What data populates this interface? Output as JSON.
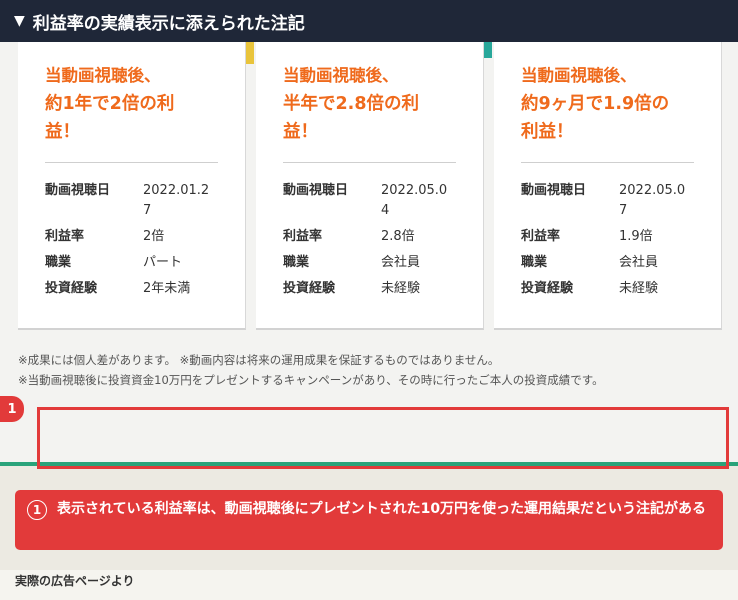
{
  "header": {
    "arrow": "▼",
    "title": "利益率の実績表示に添えられた注記"
  },
  "cards": [
    {
      "headline_lines": [
        "当動画視聴後、",
        "約1年で2倍の利",
        "益！"
      ],
      "rows": [
        {
          "label": "動画視聴日",
          "value": "2022.01.2\n7"
        },
        {
          "label": "利益率",
          "value": "2倍"
        },
        {
          "label": "職業",
          "value": "パート"
        },
        {
          "label": "投資経験",
          "value": "2年未満"
        }
      ]
    },
    {
      "headline_lines": [
        "当動画視聴後、",
        "半年で2.8倍の利",
        "益！"
      ],
      "rows": [
        {
          "label": "動画視聴日",
          "value": "2022.05.0\n4"
        },
        {
          "label": "利益率",
          "value": "2.8倍"
        },
        {
          "label": "職業",
          "value": "会社員"
        },
        {
          "label": "投資経験",
          "value": "未経験"
        }
      ]
    },
    {
      "headline_lines": [
        "当動画視聴後、",
        "約9ヶ月で1.9倍の",
        "利益！"
      ],
      "rows": [
        {
          "label": "動画視聴日",
          "value": "2022.05.0\n7"
        },
        {
          "label": "利益率",
          "value": "1.9倍"
        },
        {
          "label": "職業",
          "value": "会社員"
        },
        {
          "label": "投資経験",
          "value": "未経験"
        }
      ]
    }
  ],
  "notes": [
    "※成果には個人差があります。 ※動画内容は将来の運用成果を保証するものではありません。",
    "※当動画視聴後に投資資金10万円をプレゼントするキャンペーンがあり、その時に行ったご本人の投資成績です。"
  ],
  "highlight_badge": "1",
  "callout": {
    "number": "1",
    "text": "表示されている利益率は、動画視聴後にプレゼントされた10万円を使った運用結果だという注記がある"
  },
  "source": "実際の広告ページより",
  "colors": {
    "header_bg": "#1f2738",
    "accent_orange": "#ef6a1c",
    "alert_red": "#e23a3a",
    "green_line": "#2aa37a"
  }
}
